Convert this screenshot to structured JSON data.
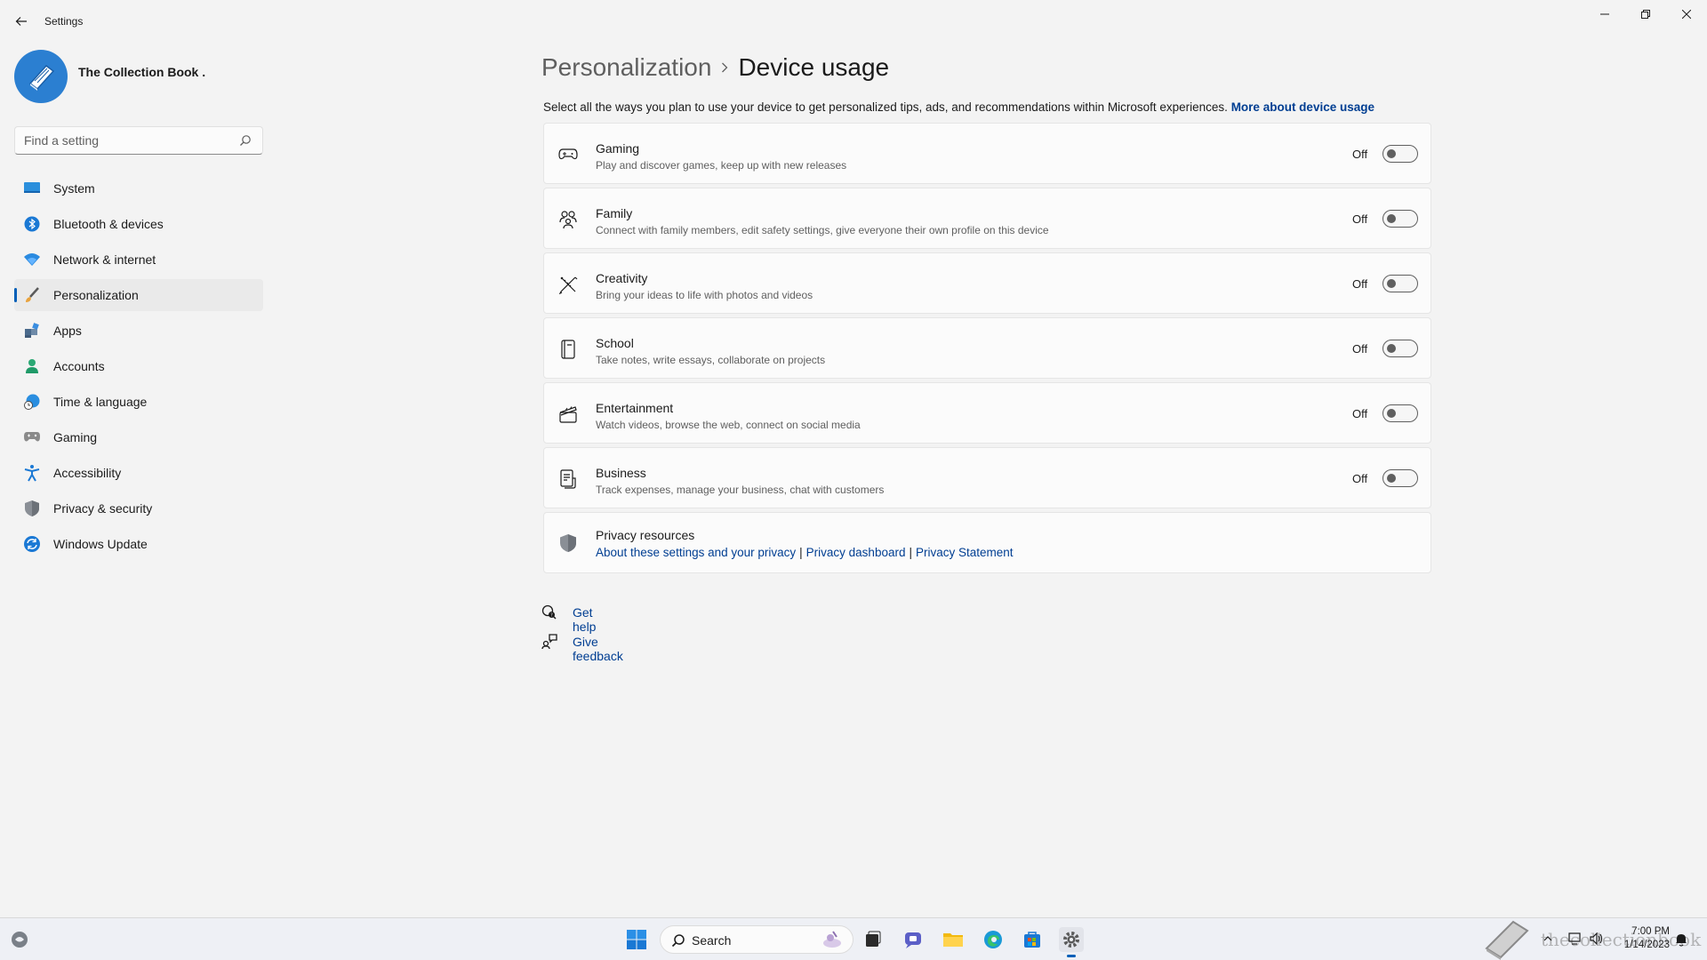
{
  "window": {
    "title": "Settings"
  },
  "profile": {
    "name": "The Collection Book ."
  },
  "search": {
    "placeholder": "Find a setting"
  },
  "sidebar": {
    "items": [
      {
        "label": "System",
        "icon": "monitor-icon"
      },
      {
        "label": "Bluetooth & devices",
        "icon": "bluetooth-icon"
      },
      {
        "label": "Network & internet",
        "icon": "wifi-icon"
      },
      {
        "label": "Personalization",
        "icon": "brush-icon",
        "active": true
      },
      {
        "label": "Apps",
        "icon": "apps-icon"
      },
      {
        "label": "Accounts",
        "icon": "person-icon"
      },
      {
        "label": "Time & language",
        "icon": "globe-clock-icon"
      },
      {
        "label": "Gaming",
        "icon": "gamepad-icon"
      },
      {
        "label": "Accessibility",
        "icon": "accessibility-icon"
      },
      {
        "label": "Privacy & security",
        "icon": "shield-icon"
      },
      {
        "label": "Windows Update",
        "icon": "update-icon"
      }
    ]
  },
  "breadcrumb": {
    "parent": "Personalization",
    "current": "Device usage"
  },
  "intro": {
    "text": "Select all the ways you plan to use your device to get personalized tips, ads, and recommendations within Microsoft experiences.",
    "link": "More about device usage"
  },
  "usage_options": [
    {
      "title": "Gaming",
      "description": "Play and discover games, keep up with new releases",
      "state": "Off",
      "icon": "gamepad-icon"
    },
    {
      "title": "Family",
      "description": "Connect with family members, edit safety settings, give everyone their own profile on this device",
      "state": "Off",
      "icon": "family-icon"
    },
    {
      "title": "Creativity",
      "description": "Bring your ideas to life with photos and videos",
      "state": "Off",
      "icon": "pen-ruler-icon"
    },
    {
      "title": "School",
      "description": "Take notes, write essays, collaborate on projects",
      "state": "Off",
      "icon": "notebook-icon"
    },
    {
      "title": "Entertainment",
      "description": "Watch videos, browse the web, connect on social media",
      "state": "Off",
      "icon": "clapperboard-icon"
    },
    {
      "title": "Business",
      "description": "Track expenses, manage your business, chat with customers",
      "state": "Off",
      "icon": "document-icon"
    }
  ],
  "privacy": {
    "title": "Privacy resources",
    "links": [
      "About these settings and your privacy",
      "Privacy dashboard",
      "Privacy Statement"
    ],
    "separator": "|"
  },
  "help": {
    "get_help": "Get help",
    "give_feedback": "Give feedback"
  },
  "taskbar": {
    "search_label": "Search",
    "time": "7:00 PM",
    "date": "1/14/2023",
    "watermark": "thecollectionbook"
  },
  "colors": {
    "accent": "#005fb8",
    "link": "#003e92",
    "background": "#f3f3f3",
    "card": "#fbfbfb"
  }
}
